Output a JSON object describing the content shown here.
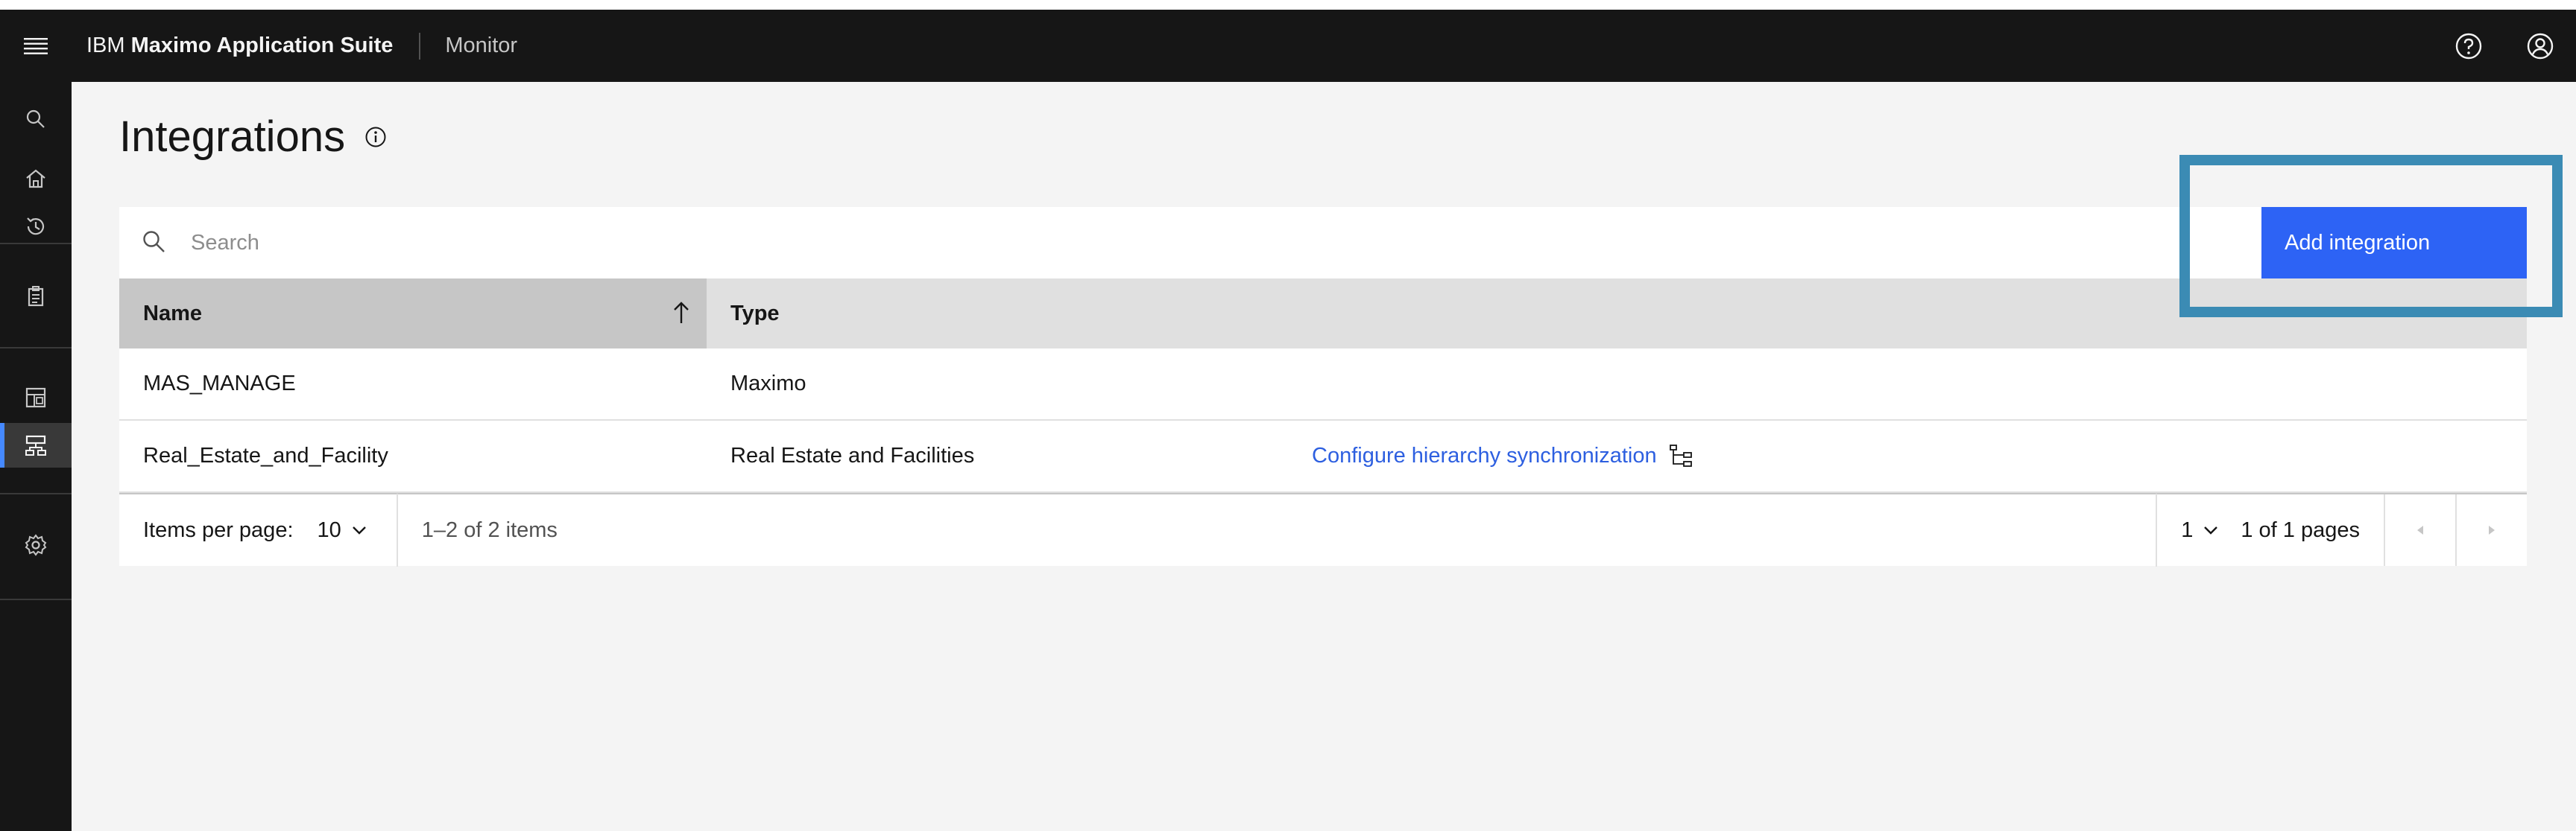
{
  "header": {
    "brand_prefix": "IBM",
    "brand_name": "Maximo Application Suite",
    "product": "Monitor",
    "icons": [
      "menu-icon",
      "help-icon",
      "user-avatar-icon"
    ]
  },
  "sidenav": {
    "items": [
      {
        "icon": "search-icon",
        "active": false
      },
      {
        "icon": "home-icon",
        "active": false
      },
      {
        "icon": "recent-icon",
        "active": false
      },
      {
        "icon": "clipboard-icon",
        "active": false
      },
      {
        "icon": "dashboard-icon",
        "active": false
      },
      {
        "icon": "integrations-icon",
        "active": true
      },
      {
        "icon": "settings-icon",
        "active": false
      }
    ]
  },
  "page": {
    "title": "Integrations"
  },
  "toolbar": {
    "search_placeholder": "Search",
    "add_label": "Add integration"
  },
  "table": {
    "columns": [
      "Name",
      "Type"
    ],
    "rows": [
      {
        "name": "MAS_MANAGE",
        "type": "Maximo",
        "action": ""
      },
      {
        "name": "Real_Estate_and_Facility",
        "type": "Real Estate and Facilities",
        "action": "Configure hierarchy synchronization"
      }
    ]
  },
  "pagination": {
    "items_per_page_label": "Items per page:",
    "items_per_page": "10",
    "range": "1–2 of 2 items",
    "page": "1",
    "of_pages": "1 of 1 pages"
  },
  "colors": {
    "header_bg": "#161616",
    "primary_button": "#2d63f5",
    "highlight": "#3b8bb4",
    "link": "#2d5fe0"
  }
}
